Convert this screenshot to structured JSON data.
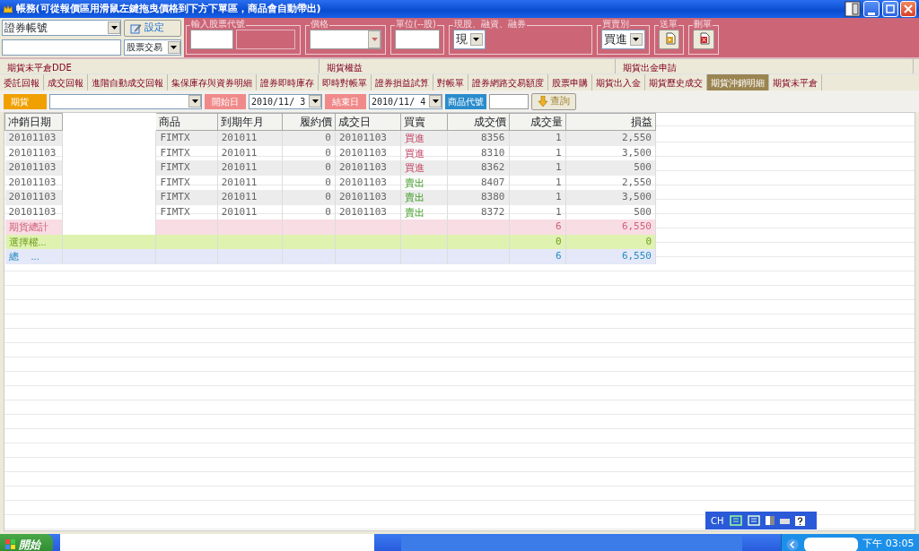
{
  "window": {
    "title": "帳務(可從報價區用滑鼠左鍵拖曳價格到下方下單區，商品會自動帶出)"
  },
  "toolbar": {
    "account_select": {
      "value": "證券帳號"
    },
    "settings_button": {
      "label": "設定"
    },
    "trade_type_select": {
      "value": "股票交易"
    },
    "groups": [
      {
        "kind": "code",
        "legend": "輸入股票代號"
      },
      {
        "kind": "price",
        "legend": "價格"
      },
      {
        "kind": "units",
        "legend": "單位(--股)"
      },
      {
        "kind": "select",
        "legend": "現股、融資、融券",
        "value": "現"
      },
      {
        "kind": "select",
        "legend": "買賣別",
        "value": "買進"
      },
      {
        "kind": "send",
        "legend": "送單"
      },
      {
        "kind": "delete",
        "legend": "刪單"
      }
    ]
  },
  "tabs_upper": [
    {
      "label": "期貨未平倉DDE"
    },
    {
      "label": "期貨權益"
    },
    {
      "label": "期貨出金申請"
    }
  ],
  "tabs": [
    {
      "label": "委託回報",
      "selected": false
    },
    {
      "label": "成交回報",
      "selected": false
    },
    {
      "label": "進階自動成交回報",
      "selected": false
    },
    {
      "label": "集保庫存與資券明細",
      "selected": false
    },
    {
      "label": "證券即時庫存",
      "selected": false
    },
    {
      "label": "即時對帳單",
      "selected": false
    },
    {
      "label": "證券損益試算",
      "selected": false
    },
    {
      "label": "對帳單",
      "selected": false
    },
    {
      "label": "證券網路交易額度",
      "selected": false
    },
    {
      "label": "股票申購",
      "selected": false
    },
    {
      "label": "期貨出入金",
      "selected": false
    },
    {
      "label": "期貨歷史成交",
      "selected": false
    },
    {
      "label": "期貨沖銷明細",
      "selected": true
    },
    {
      "label": "期貨未平倉",
      "selected": false
    }
  ],
  "filter": {
    "category": "期貨",
    "start_label": "開始日",
    "start_date": "2010/11/ 3",
    "end_label": "結束日",
    "end_date": "2010/11/ 4",
    "code_label": "商品代號",
    "query_button": "查詢"
  },
  "table": {
    "columns": [
      {
        "label": "冲銷日期",
        "kind": "text"
      },
      {
        "kind": "hidden"
      },
      {
        "label": "商品",
        "kind": "text"
      },
      {
        "label": "到期年月",
        "kind": "text"
      },
      {
        "label": "履約價",
        "kind": "number"
      },
      {
        "label": "成交日",
        "kind": "text"
      },
      {
        "label": "買賣",
        "kind": "side"
      },
      {
        "label": "成交價",
        "kind": "number"
      },
      {
        "label": "成交量",
        "kind": "number"
      },
      {
        "label": "損益",
        "kind": "number"
      }
    ],
    "rows": [
      {
        "kind": "buy",
        "cells": [
          "20101103",
          "FIMTX",
          "201011",
          "0",
          "20101103",
          "買進",
          "8356",
          "1",
          "2,550"
        ]
      },
      {
        "kind": "buy",
        "cells": [
          "20101103",
          "FIMTX",
          "201011",
          "0",
          "20101103",
          "買進",
          "8310",
          "1",
          "3,500"
        ]
      },
      {
        "kind": "buy",
        "cells": [
          "20101103",
          "FIMTX",
          "201011",
          "0",
          "20101103",
          "買進",
          "8362",
          "1",
          "500"
        ]
      },
      {
        "kind": "sell",
        "cells": [
          "20101103",
          "FIMTX",
          "201011",
          "0",
          "20101103",
          "賣出",
          "8407",
          "1",
          "2,550"
        ]
      },
      {
        "kind": "sell",
        "cells": [
          "20101103",
          "FIMTX",
          "201011",
          "0",
          "20101103",
          "賣出",
          "8380",
          "1",
          "3,500"
        ]
      },
      {
        "kind": "sell",
        "cells": [
          "20101103",
          "FIMTX",
          "201011",
          "0",
          "20101103",
          "賣出",
          "8372",
          "1",
          "500"
        ]
      },
      {
        "kind": "futures-total",
        "label": "期貨總計",
        "qty": "6",
        "pnl": "6,550"
      },
      {
        "kind": "options-total",
        "label": "選擇權...",
        "qty": "0",
        "pnl": "0"
      },
      {
        "kind": "grand-total",
        "label": "總　 ...",
        "qty": "6",
        "pnl": "6,550"
      }
    ]
  },
  "language_bar": {
    "code": "CH"
  },
  "taskbar": {
    "start": "開始",
    "clock": "下午 03:05"
  }
}
